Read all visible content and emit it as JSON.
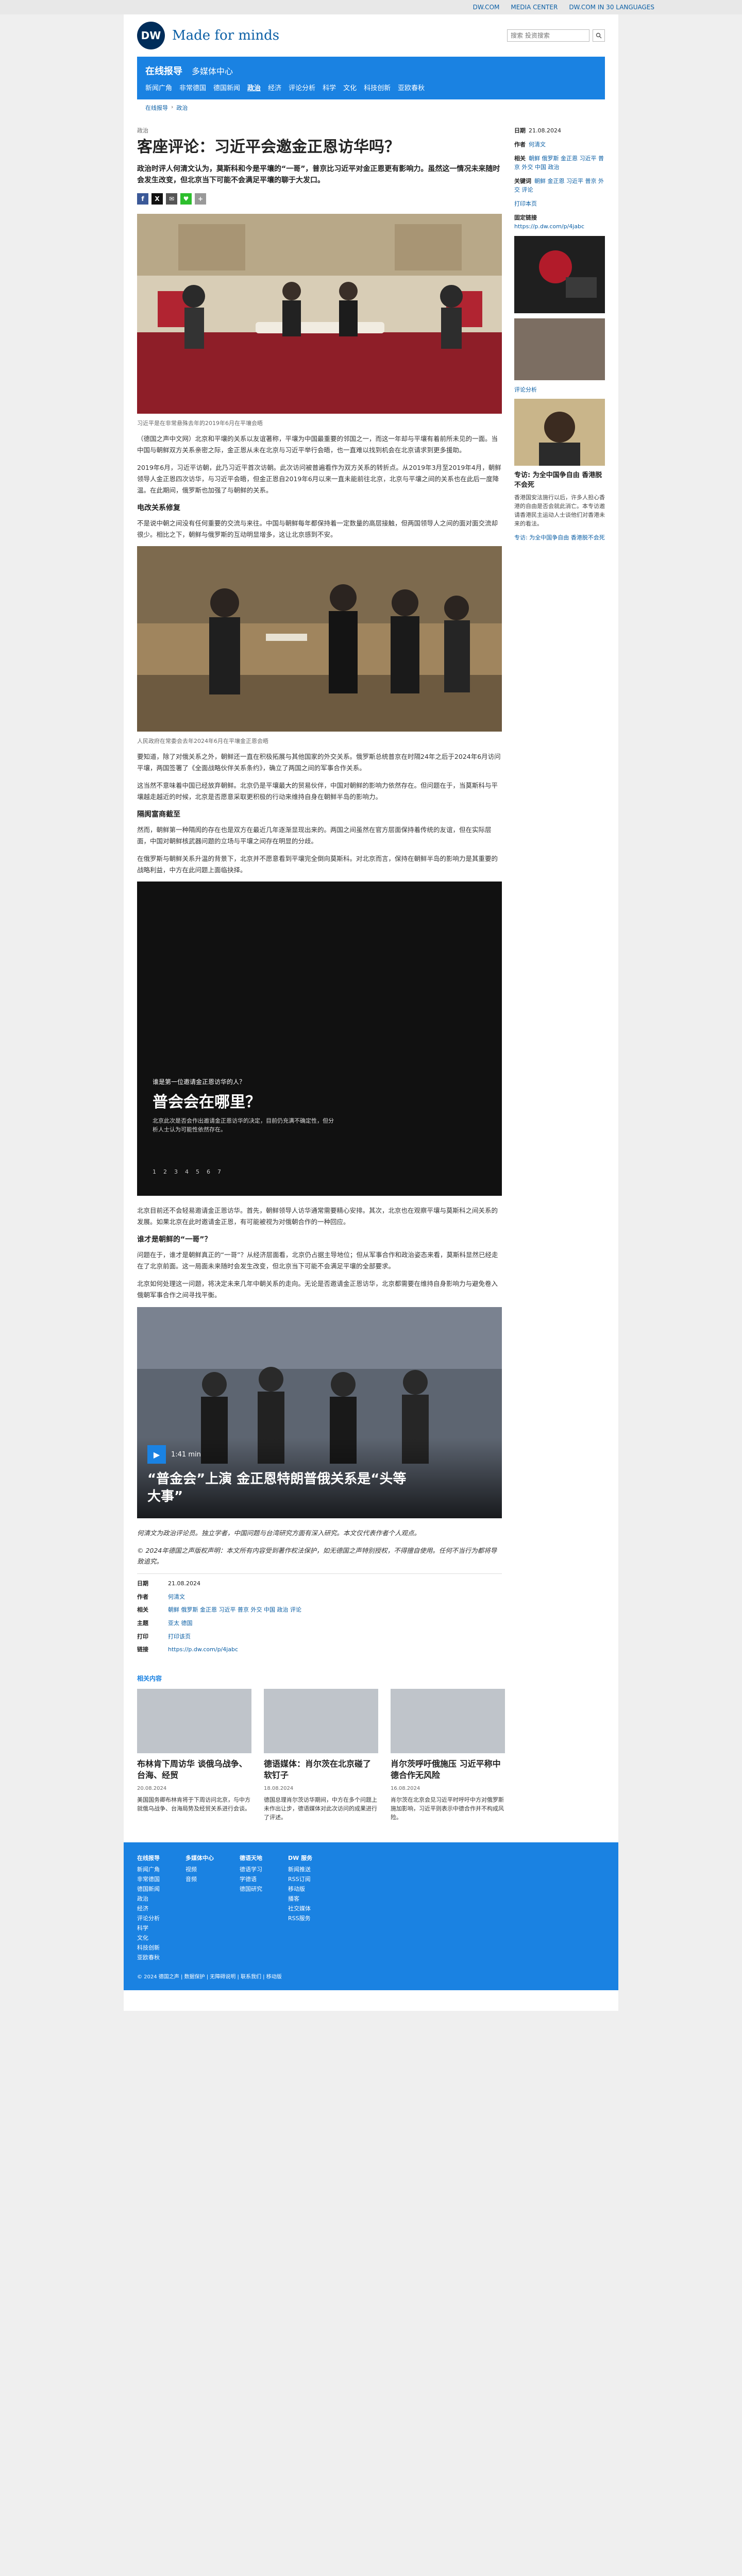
{
  "topbar": {
    "links": [
      "DW.COM",
      "MEDIA CENTER",
      "DW.COM IN 30 LANGUAGES"
    ]
  },
  "header": {
    "logo": "DW",
    "tagline": "Made for minds",
    "search_placeholder": "搜索 投资搜索"
  },
  "nav": {
    "title": "在线报导",
    "subtitle": "多媒体中心",
    "items": [
      "新闻广角",
      "非常德国",
      "德国新闻",
      "政治",
      "经济",
      "评论分析",
      "科学",
      "文化",
      "科技创新",
      "亚欧春秋"
    ],
    "active_index": 3
  },
  "breadcrumb": [
    "在线报导",
    "政治"
  ],
  "article": {
    "kicker": "政治",
    "headline": "客座评论：习近平会邀金正恩访华吗？",
    "lead": "政治时评人何清文认为，莫斯科和今是平壤的“一哥”，普京比习近平对金正恩更有影响力。虽然这一情况未来随时会发生改变，但北京当下可能不会满足平壤的聊于大发口。",
    "share_labels": [
      "f",
      "X",
      "✉",
      "♥",
      "+"
    ],
    "photo1_caption": "习近平是在非常悬殊去年的2019年6月在平壤会晤",
    "paragraphs1": [
      "（德国之声中文网）北京和平壤的关系以友谊著称，平壤为中国最重要的邻国之一，而这一年却与平壤有着前所未见的一面。当中国与朝鲜双方关系亲密之际，金正恩从未在北京与习近平举行会晤，也一直难以找到机会在北京请求到更多援助。",
      "2019年6月，习近平访朝，此乃习近平首次访朝。此次访问被普遍看作为双方关系的转折点。从2019年3月至2019年4月，朝鲜领导人金正恩四次访华，与习近平会晤，但金正恩自2019年6月以来一直未能前往北京，北京与平壤之间的关系也在此后一度降温。在此期间，俄罗斯也加强了与朝鲜的关系。"
    ],
    "subhead1": "电改关系修复",
    "paragraphs2": [
      "不是说中朝之间没有任何重要的交流与来往。中国与朝鲜每年都保持着一定数量的高层接触，但两国领导人之间的面对面交流却很少。相比之下，朝鲜与俄罗斯的互动明显增多，这让北京感到不安。"
    ],
    "photo2_caption": "人民政府在常委会去年2024年6月在平壤金正恩会晤",
    "paragraphs3": [
      "要知道，除了对俄关系之外，朝鲜还一直在积极拓展与其他国家的外交关系。俄罗斯总统普京在时隔24年之后于2024年6月访问平壤，两国签署了《全面战略伙伴关系条约》，确立了两国之间的军事合作关系。",
      "这当然不意味着中国已经放弃朝鲜。北京仍是平壤最大的贸易伙伴，中国对朝鲜的影响力依然存在。但问题在于，当莫斯科与平壤越走越近的时候，北京是否愿意采取更积极的行动来维持自身在朝鲜半岛的影响力。"
    ],
    "subhead2": "隔阂富商截至",
    "paragraphs4": [
      "然而，朝鲜第一种隔阂的存在也是双方在最近几年逐渐显现出来的。两国之间虽然在官方层面保持着传统的友谊，但在实际层面，中国对朝鲜核武器问题的立场与平壤之间存在明显的分歧。",
      "在俄罗斯与朝鲜关系升温的背景下，北京并不愿意看到平壤完全倒向莫斯科。对北京而言，保持在朝鲜半岛的影响力是其重要的战略利益，中方在此问题上面临抉择。"
    ],
    "video": {
      "small": "谁是第一位邀请金正恩访华的人？",
      "big": "普会会在哪里？",
      "desc": "北京此次是否会作出邀请金正恩访华的决定，目前仍充满不确定性，但分析人士认为可能性依然存在。",
      "nums": [
        "1",
        "2",
        "3",
        "4",
        "5",
        "6",
        "7"
      ]
    },
    "paragraphs5": [
      "北京目前还不会轻易邀请金正恩访华。首先，朝鲜领导人访华通常需要精心安排。其次，北京也在观察平壤与莫斯科之间关系的发展。如果北京在此时邀请金正恩，有可能被视为对俄朝合作的一种回应。"
    ],
    "subhead3": "谁才是朝鲜的“一哥”？",
    "paragraphs6": [
      "问题在于，谁才是朝鲜真正的“一哥”？从经济层面看，北京仍占据主导地位；但从军事合作和政治姿态来看，莫斯科显然已经走在了北京前面。这一局面未来随时会发生改变，但北京当下可能不会满足平壤的全部要求。"
    ],
    "paragraphs7": [
      "北京如何处理这一问题，将决定未来几年中朝关系的走向。无论是否邀请金正恩访华，北京都需要在维持自身影响力与避免卷入俄朝军事合作之间寻找平衡。"
    ],
    "embed": {
      "duration": "1:41 min",
      "title": "“普金会”上演 金正恩特朗普俄关系是“头等大事”"
    },
    "footnote": "何清文为政治评论员。独立学者，中国问题与台湾研究方面有深入研究。本文仅代表作者个人观点。",
    "copyright": "© 2024年德国之声版权声明：本文所有内容受到著作权法保护，如无德国之声特别授权，不得擅自使用。任何不当行为都将导致追究。"
  },
  "meta": {
    "date_label": "日期",
    "date": "21.08.2024",
    "author_label": "作者",
    "author": "何清文",
    "tags_label": "相关",
    "tags": "朝鲜 俄罗斯 金正恩 习近平 普京 外交 中国 政治 评论",
    "topic_label": "主题",
    "topic": "亚太 德国",
    "print_label": "打印",
    "print": "打印该页",
    "link_label": "链接",
    "link": "https://p.dw.com/p/4jabc"
  },
  "sidebar": {
    "date_label": "日期",
    "date": "21.08.2024",
    "author_label": "作者",
    "author": "何清文",
    "related_label": "相关",
    "related": "朝鲜 俄罗斯 金正恩 习近平 普京 外交 中国 政治",
    "keywords_label": "关键词",
    "keywords": "朝鲜 金正恩 习近平 普京 外交 评论",
    "print": "打印本页",
    "link_label": "固定链接",
    "link": "https://p.dw.com/p/4jabc",
    "promo_kicker": "评论分析",
    "promo_title": "专访: 为全中国争自由 香港脱不会死",
    "promo_desc": "香港国安法施行以后，许多人担心香港的自由是否会就此消亡。本专访邀请香港民主运动人士谈他们对香港未来的看法。",
    "promo_link": "专访: 为全中国争自由 香港脱不会死"
  },
  "related": {
    "heading": "相关内容",
    "cards": [
      {
        "title": "布林肯下周访华 谈俄乌战争、台海、经贸",
        "date": "20.08.2024",
        "summary": "美国国务卿布林肯将于下周访问北京，与中方就俄乌战争、台海局势及经贸关系进行会谈。"
      },
      {
        "title": "德语媒体：肖尔茨在北京碰了软钉子",
        "date": "18.08.2024",
        "summary": "德国总理肖尔茨访华期间，中方在多个问题上未作出让步，德语媒体对此次访问的成果进行了评述。"
      },
      {
        "title": "肖尔茨呼吁俄施压 习近平称中德合作无风险",
        "date": "16.08.2024",
        "summary": "肖尔茨在北京会见习近平时呼吁中方对俄罗斯施加影响，习近平则表示中德合作并不构成风险。"
      }
    ]
  },
  "footer": {
    "cols": [
      {
        "head": "在线报导",
        "items": [
          "新闻广角",
          "非常德国",
          "德国新闻",
          "政治",
          "经济",
          "评论分析",
          "科学",
          "文化",
          "科技创新",
          "亚欧春秋"
        ]
      },
      {
        "head": "多媒体中心",
        "items": [
          "视频",
          "音频"
        ]
      },
      {
        "head": "德语天地",
        "items": [
          "德语学习",
          "学德语",
          "德国研究"
        ]
      },
      {
        "head": "DW 服务",
        "items": [
          "新闻推送",
          "RSS订阅",
          "移动版",
          "播客",
          "社交媒体",
          "RSS服务"
        ]
      }
    ],
    "bottom": "© 2024 德国之声 | 数据保护 | 无障碍说明 | 联系我们 | 移动版"
  },
  "colors": {
    "brand_blue": "#1a82e2",
    "dw_navy": "#002d5a",
    "link": "#0b5fa5"
  }
}
